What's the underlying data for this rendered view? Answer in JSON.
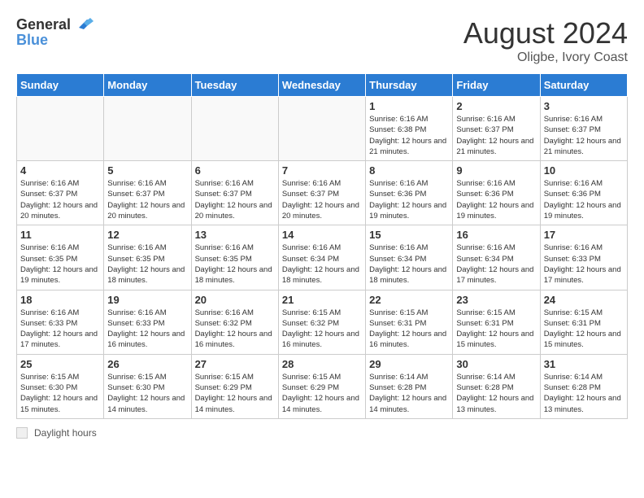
{
  "header": {
    "logo": {
      "text_general": "General",
      "text_blue": "Blue"
    },
    "month_year": "August 2024",
    "location": "Oligbe, Ivory Coast"
  },
  "calendar": {
    "days_of_week": [
      "Sunday",
      "Monday",
      "Tuesday",
      "Wednesday",
      "Thursday",
      "Friday",
      "Saturday"
    ],
    "weeks": [
      [
        {
          "day": "",
          "info": ""
        },
        {
          "day": "",
          "info": ""
        },
        {
          "day": "",
          "info": ""
        },
        {
          "day": "",
          "info": ""
        },
        {
          "day": "1",
          "info": "Sunrise: 6:16 AM\nSunset: 6:38 PM\nDaylight: 12 hours and 21 minutes."
        },
        {
          "day": "2",
          "info": "Sunrise: 6:16 AM\nSunset: 6:37 PM\nDaylight: 12 hours and 21 minutes."
        },
        {
          "day": "3",
          "info": "Sunrise: 6:16 AM\nSunset: 6:37 PM\nDaylight: 12 hours and 21 minutes."
        }
      ],
      [
        {
          "day": "4",
          "info": "Sunrise: 6:16 AM\nSunset: 6:37 PM\nDaylight: 12 hours and 20 minutes."
        },
        {
          "day": "5",
          "info": "Sunrise: 6:16 AM\nSunset: 6:37 PM\nDaylight: 12 hours and 20 minutes."
        },
        {
          "day": "6",
          "info": "Sunrise: 6:16 AM\nSunset: 6:37 PM\nDaylight: 12 hours and 20 minutes."
        },
        {
          "day": "7",
          "info": "Sunrise: 6:16 AM\nSunset: 6:37 PM\nDaylight: 12 hours and 20 minutes."
        },
        {
          "day": "8",
          "info": "Sunrise: 6:16 AM\nSunset: 6:36 PM\nDaylight: 12 hours and 19 minutes."
        },
        {
          "day": "9",
          "info": "Sunrise: 6:16 AM\nSunset: 6:36 PM\nDaylight: 12 hours and 19 minutes."
        },
        {
          "day": "10",
          "info": "Sunrise: 6:16 AM\nSunset: 6:36 PM\nDaylight: 12 hours and 19 minutes."
        }
      ],
      [
        {
          "day": "11",
          "info": "Sunrise: 6:16 AM\nSunset: 6:35 PM\nDaylight: 12 hours and 19 minutes."
        },
        {
          "day": "12",
          "info": "Sunrise: 6:16 AM\nSunset: 6:35 PM\nDaylight: 12 hours and 18 minutes."
        },
        {
          "day": "13",
          "info": "Sunrise: 6:16 AM\nSunset: 6:35 PM\nDaylight: 12 hours and 18 minutes."
        },
        {
          "day": "14",
          "info": "Sunrise: 6:16 AM\nSunset: 6:34 PM\nDaylight: 12 hours and 18 minutes."
        },
        {
          "day": "15",
          "info": "Sunrise: 6:16 AM\nSunset: 6:34 PM\nDaylight: 12 hours and 18 minutes."
        },
        {
          "day": "16",
          "info": "Sunrise: 6:16 AM\nSunset: 6:34 PM\nDaylight: 12 hours and 17 minutes."
        },
        {
          "day": "17",
          "info": "Sunrise: 6:16 AM\nSunset: 6:33 PM\nDaylight: 12 hours and 17 minutes."
        }
      ],
      [
        {
          "day": "18",
          "info": "Sunrise: 6:16 AM\nSunset: 6:33 PM\nDaylight: 12 hours and 17 minutes."
        },
        {
          "day": "19",
          "info": "Sunrise: 6:16 AM\nSunset: 6:33 PM\nDaylight: 12 hours and 16 minutes."
        },
        {
          "day": "20",
          "info": "Sunrise: 6:16 AM\nSunset: 6:32 PM\nDaylight: 12 hours and 16 minutes."
        },
        {
          "day": "21",
          "info": "Sunrise: 6:15 AM\nSunset: 6:32 PM\nDaylight: 12 hours and 16 minutes."
        },
        {
          "day": "22",
          "info": "Sunrise: 6:15 AM\nSunset: 6:31 PM\nDaylight: 12 hours and 16 minutes."
        },
        {
          "day": "23",
          "info": "Sunrise: 6:15 AM\nSunset: 6:31 PM\nDaylight: 12 hours and 15 minutes."
        },
        {
          "day": "24",
          "info": "Sunrise: 6:15 AM\nSunset: 6:31 PM\nDaylight: 12 hours and 15 minutes."
        }
      ],
      [
        {
          "day": "25",
          "info": "Sunrise: 6:15 AM\nSunset: 6:30 PM\nDaylight: 12 hours and 15 minutes."
        },
        {
          "day": "26",
          "info": "Sunrise: 6:15 AM\nSunset: 6:30 PM\nDaylight: 12 hours and 14 minutes."
        },
        {
          "day": "27",
          "info": "Sunrise: 6:15 AM\nSunset: 6:29 PM\nDaylight: 12 hours and 14 minutes."
        },
        {
          "day": "28",
          "info": "Sunrise: 6:15 AM\nSunset: 6:29 PM\nDaylight: 12 hours and 14 minutes."
        },
        {
          "day": "29",
          "info": "Sunrise: 6:14 AM\nSunset: 6:28 PM\nDaylight: 12 hours and 14 minutes."
        },
        {
          "day": "30",
          "info": "Sunrise: 6:14 AM\nSunset: 6:28 PM\nDaylight: 12 hours and 13 minutes."
        },
        {
          "day": "31",
          "info": "Sunrise: 6:14 AM\nSunset: 6:28 PM\nDaylight: 12 hours and 13 minutes."
        }
      ]
    ]
  },
  "footer": {
    "label": "Daylight hours"
  }
}
